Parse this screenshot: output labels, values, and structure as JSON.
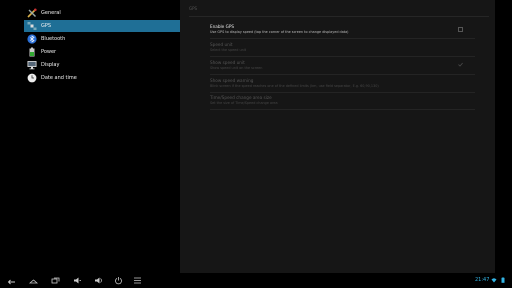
{
  "sidebar": {
    "items": [
      {
        "label": "General"
      },
      {
        "label": "GPS"
      },
      {
        "label": "Bluetooth"
      },
      {
        "label": "Power"
      },
      {
        "label": "Display"
      },
      {
        "label": "Date and time"
      }
    ]
  },
  "main": {
    "header": "GPS",
    "prefs": [
      {
        "title": "Enable GPS",
        "summary": "Use GPS to display speed (tap the corner of the screen to change displayed data)"
      },
      {
        "title": "Speed unit",
        "summary": "Select the speed unit"
      },
      {
        "title": "Show speed unit",
        "summary": "Show speed unit on the screen"
      },
      {
        "title": "Show speed warning",
        "summary": "Blink screen if the speed reaches one of the defined limits (km, use field separator, E.g. 60,90,130)"
      },
      {
        "title": "Time/Speed change area size",
        "summary": "Set the size of Time/Speed change area"
      }
    ]
  },
  "statusbar": {
    "time": "21:47"
  },
  "colors": {
    "accent": "#1f6f96",
    "clock": "#33b5e5"
  }
}
